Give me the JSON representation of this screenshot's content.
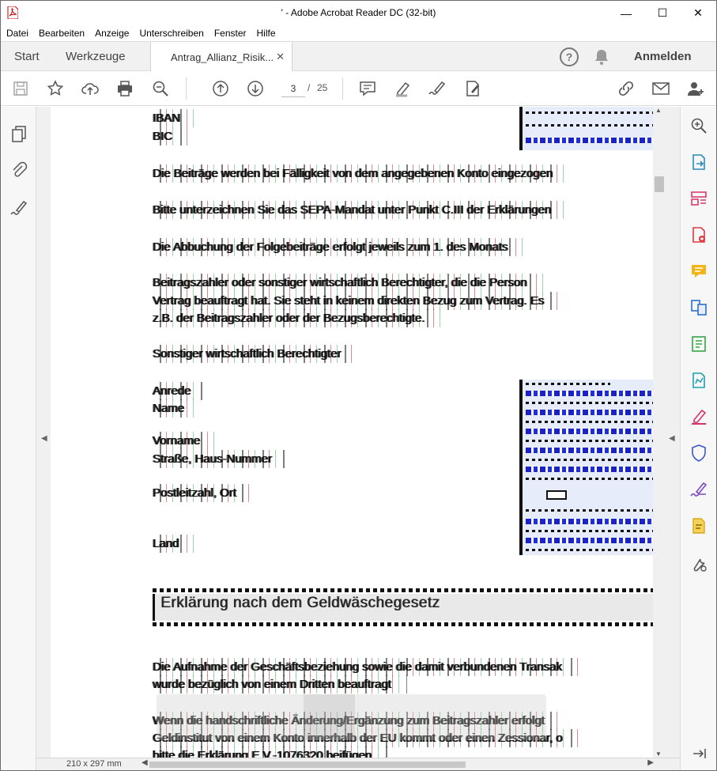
{
  "window": {
    "title": "' - Adobe Acrobat Reader DC (32-bit)",
    "minimize": "—",
    "maximize": "☐",
    "close": "✕"
  },
  "menu": [
    "Datei",
    "Bearbeiten",
    "Anzeige",
    "Unterschreiben",
    "Fenster",
    "Hilfe"
  ],
  "tabs": {
    "start": "Start",
    "tools": "Werkzeuge",
    "document": "Antrag_Allianz_Risik...",
    "close": "✕"
  },
  "header": {
    "help": "?",
    "signin": "Anmelden"
  },
  "toolbar": {
    "page_current": "3",
    "page_sep": "/",
    "page_total": "25"
  },
  "document": {
    "lines": {
      "iban": "IBAN",
      "bic": "BIC",
      "debit": "Die Beiträge werden bei Fälligkeit von dem angegebenen Konto eingezogen",
      "sign": "Bitte unterzeichnen Sie das SEPA-Mandat unter Punkt C.III der Erklärungen",
      "due": "Die Abbuchung der Folgebeiträge erfolgt jeweils zum 1. des Monats",
      "payer1": "Beitragszahler oder sonstiger wirtschaftlich Berechtigter, die die Person",
      "payer2": "Vertrag beauftragt hat. Sie steht in keinem direkten Bezug zum Vertrag. Es",
      "payer3": "z.B. der Beitragszahler oder der Bezugsberechtigte.",
      "other": "Sonstiger wirtschaftlich Berechtigter",
      "salutation": "Anrede",
      "name": "Name",
      "firstname": "Vorname",
      "street": "Straße, Haus-Nummer",
      "zip": "Postleitzahl, Ort",
      "country": "Land",
      "heading": "Erklärung nach dem Geldwäschegesetz",
      "aml1": "Die Aufnahme der Geschäftsbeziehung sowie die damit verbundenen Transak",
      "aml2": "wurde bezüglich von einem Dritten beauftragt",
      "hw1": "Wenn die handschriftliche Änderung/Ergänzung zum Beitragszahler erfolgt",
      "hw2": "Geldinstitut von einem Konto innerhalb der EU kommt oder einen Zessionar, o",
      "hw3": "bitte die Erklärung E.V.-1076320 beifügen"
    }
  },
  "statusbar": {
    "page_size": "210 x 297 mm"
  }
}
